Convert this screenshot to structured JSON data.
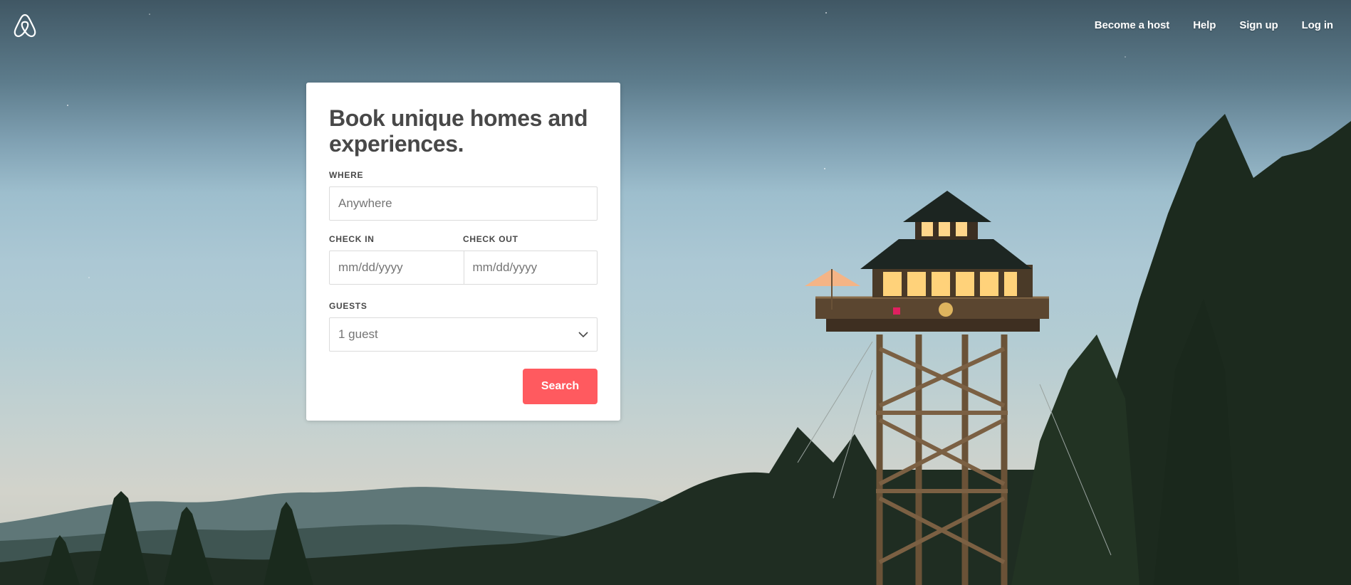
{
  "header": {
    "logo_icon": "airbnb-belo-icon",
    "nav_links": [
      "Become a host",
      "Help",
      "Sign up",
      "Log in"
    ]
  },
  "search_card": {
    "headline": "Book unique homes and experiences.",
    "where": {
      "label": "WHERE",
      "placeholder": "Anywhere"
    },
    "check_in": {
      "label": "CHECK IN",
      "placeholder": "mm/dd/yyyy"
    },
    "check_out": {
      "label": "CHECK OUT",
      "placeholder": "mm/dd/yyyy"
    },
    "guests": {
      "label": "GUESTS",
      "value": "1 guest",
      "icon": "chevron-down-icon"
    },
    "search_button": "Search"
  },
  "colors": {
    "brand": "#ff5a5f",
    "heading_text": "#484848",
    "nav_text": "#ffffff",
    "card_background": "#ffffff"
  }
}
